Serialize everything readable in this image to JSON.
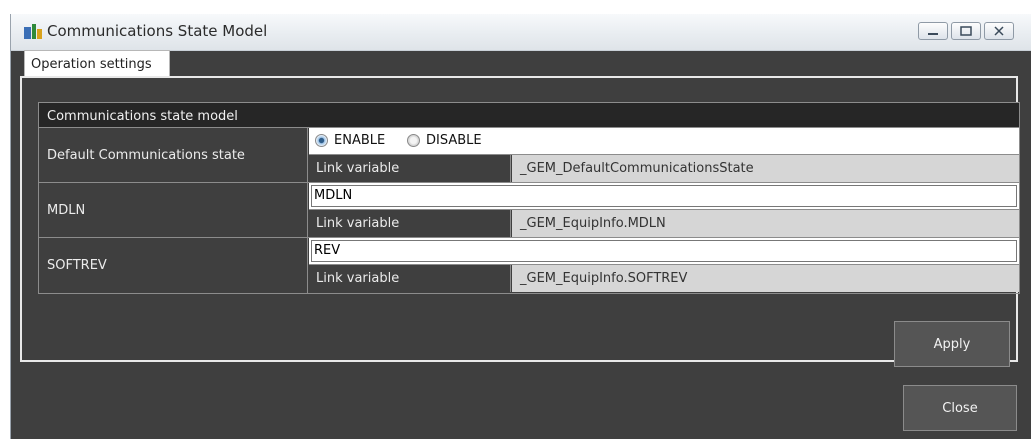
{
  "window": {
    "title": "Communications State Model",
    "controls": [
      "minimize-icon",
      "maximize-icon",
      "close-icon"
    ]
  },
  "tabs": [
    {
      "label": "Operation settings",
      "selected": true
    }
  ],
  "section": {
    "header": "Communications state model"
  },
  "rows": [
    {
      "label": "Default Communications state",
      "options": [
        {
          "label": "ENABLE",
          "selected": true
        },
        {
          "label": "DISABLE",
          "selected": false
        }
      ],
      "link_label": "Link variable",
      "link_value": "_GEM_DefaultCommunicationsState"
    },
    {
      "label": "MDLN",
      "value": "MDLN",
      "link_label": "Link variable",
      "link_value": "_GEM_EquipInfo.MDLN"
    },
    {
      "label": "SOFTREV",
      "value": "REV",
      "link_label": "Link variable",
      "link_value": "_GEM_EquipInfo.SOFTREV"
    }
  ],
  "buttons": {
    "apply": "Apply",
    "close": "Close"
  },
  "colors": {
    "background": "#3f3f3f",
    "header": "#262626",
    "link_cell": "#d6d6d6",
    "radio_selected": "#2f5d8a"
  }
}
